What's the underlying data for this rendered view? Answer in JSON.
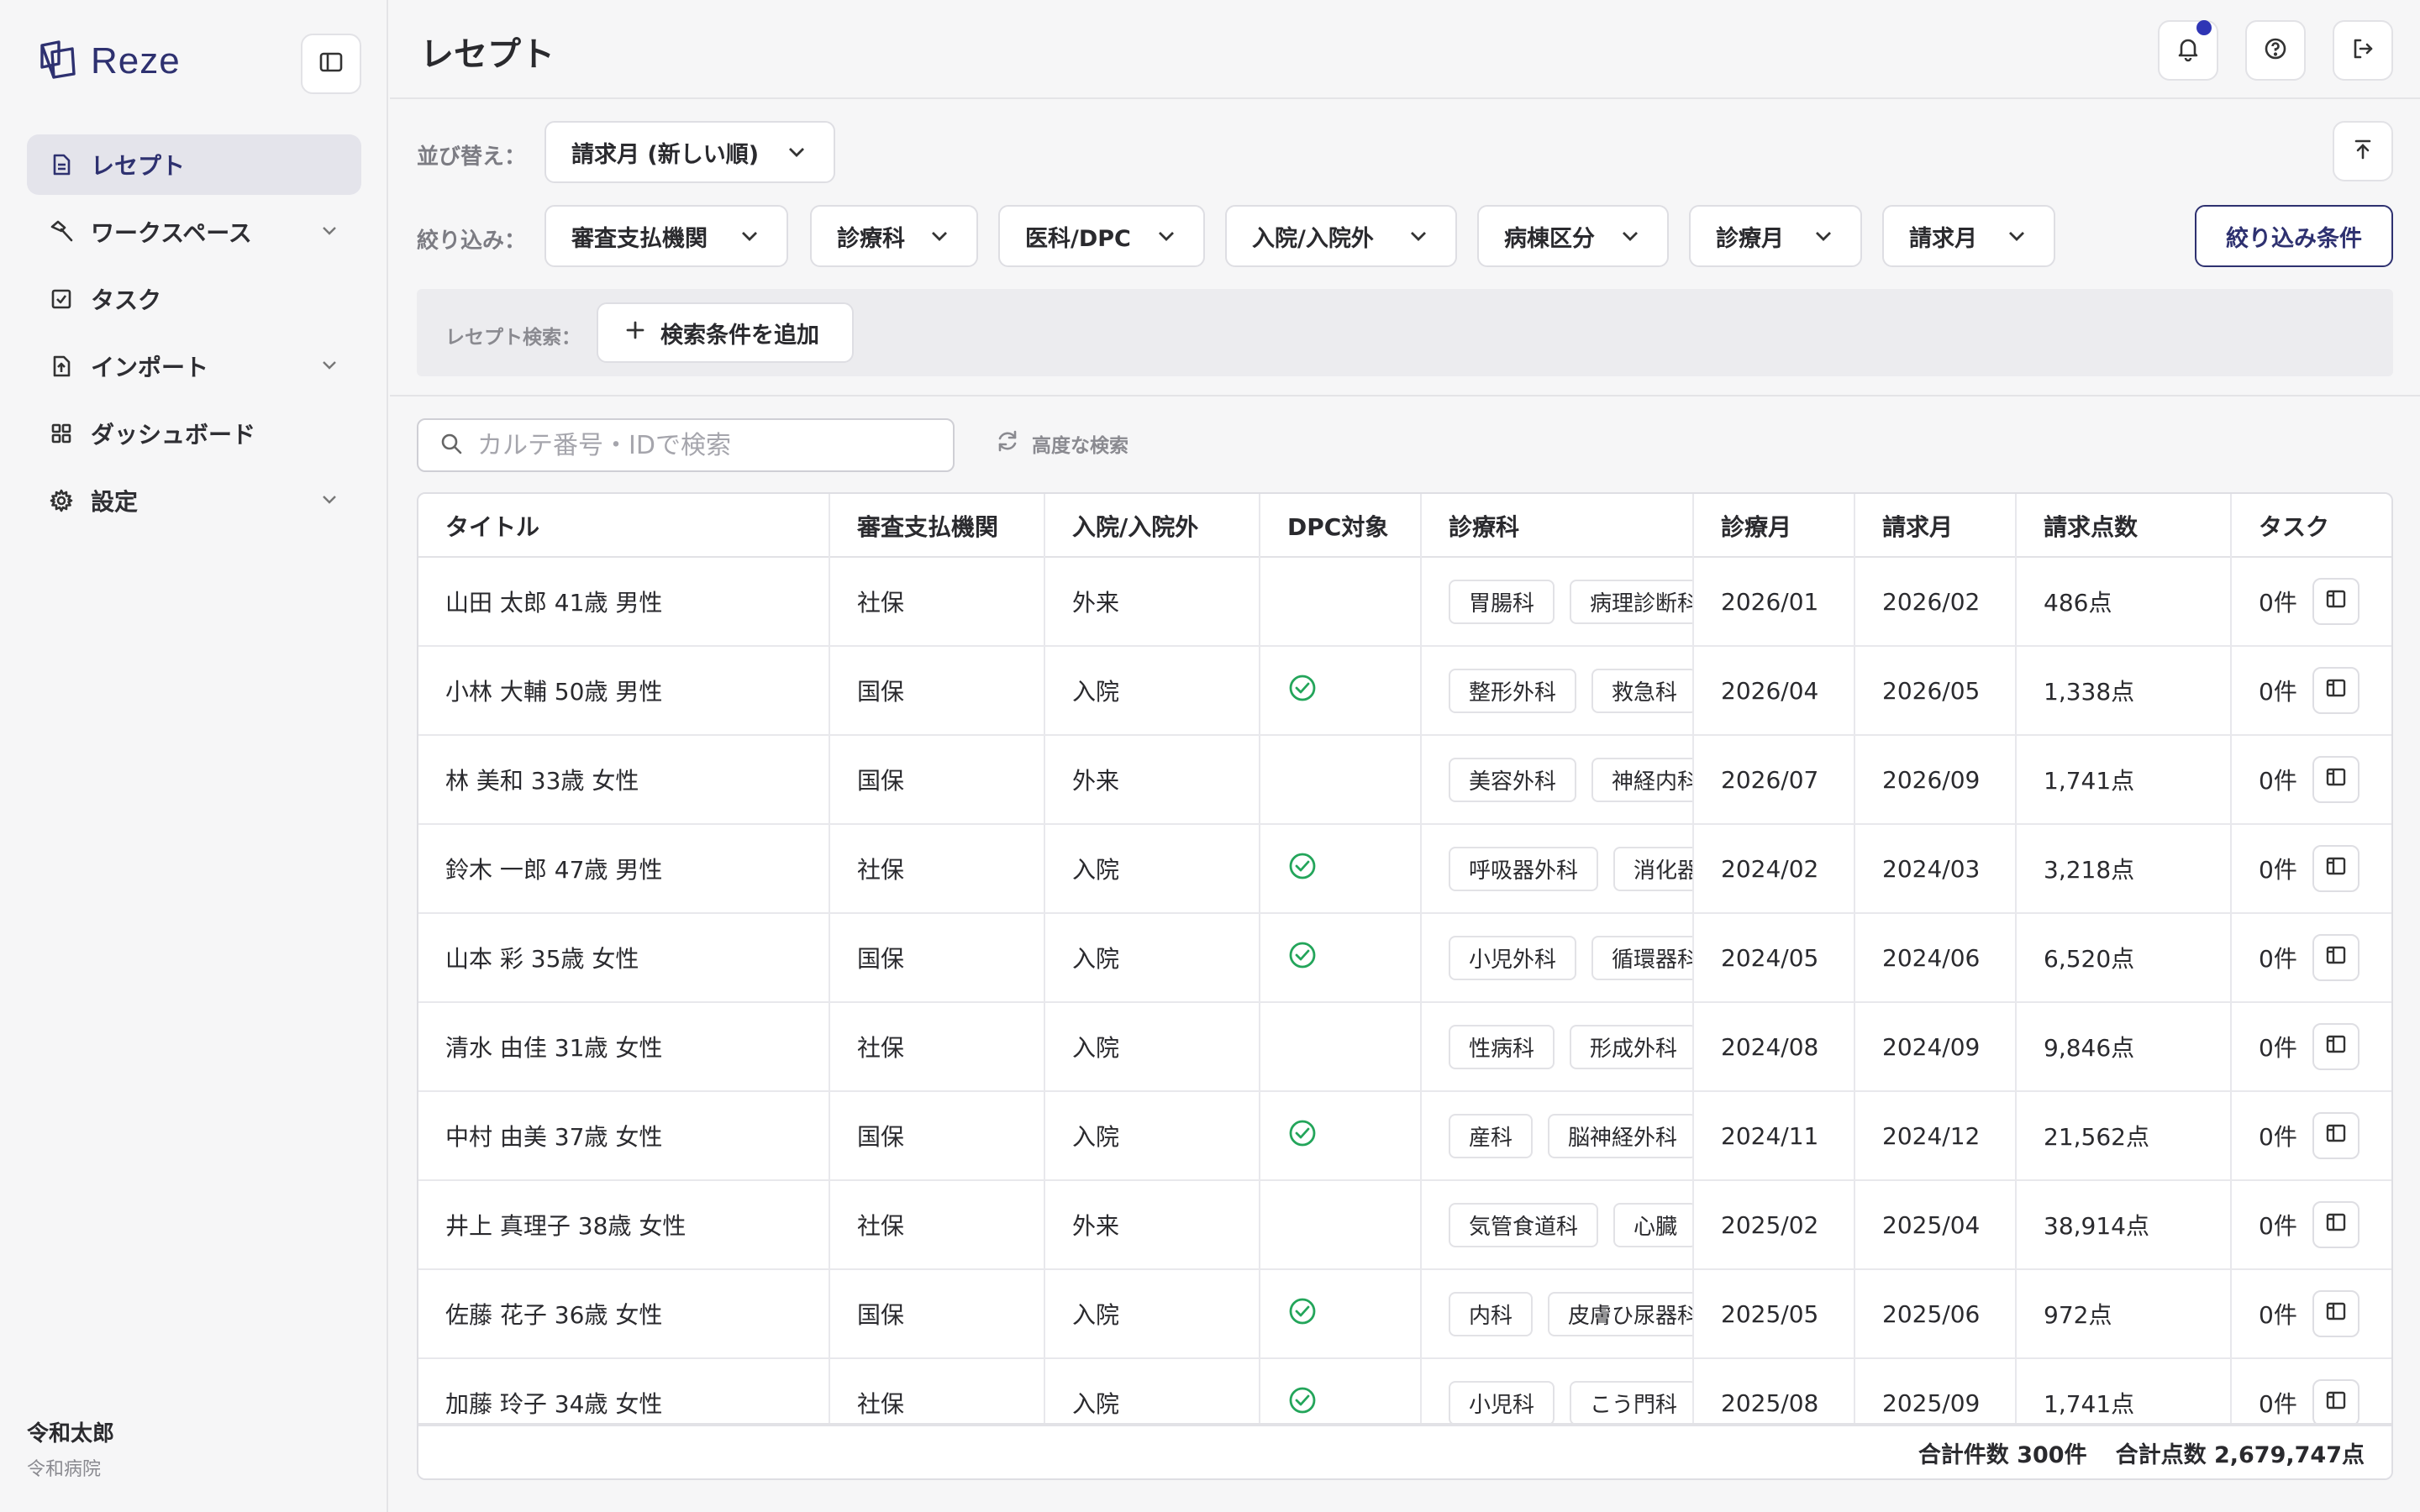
{
  "app": {
    "name": "Reze"
  },
  "sidebar": {
    "items": [
      {
        "label": "レセプト",
        "icon": "document-icon",
        "active": true,
        "expandable": false
      },
      {
        "label": "ワークスペース",
        "icon": "hammer-icon",
        "active": false,
        "expandable": true
      },
      {
        "label": "タスク",
        "icon": "checkbox-icon",
        "active": false,
        "expandable": false
      },
      {
        "label": "インポート",
        "icon": "file-import-icon",
        "active": false,
        "expandable": true
      },
      {
        "label": "ダッシュボード",
        "icon": "grid-icon",
        "active": false,
        "expandable": false
      },
      {
        "label": "設定",
        "icon": "gear-icon",
        "active": false,
        "expandable": true
      }
    ],
    "user": {
      "name": "令和太郎",
      "org": "令和病院"
    }
  },
  "header": {
    "title": "レセプト"
  },
  "colors": {
    "accent": "#2e3170",
    "notification": "#2f35b5",
    "check": "#23a55a"
  },
  "sort": {
    "label": "並び替え：",
    "value": "請求月 (新しい順)"
  },
  "filter": {
    "label": "絞り込み：",
    "dropdowns": [
      "審査支払機関",
      "診療科",
      "医科/DPC",
      "入院/入院外",
      "病棟区分",
      "診療月",
      "請求月"
    ],
    "conditions_button": "絞り込み条件"
  },
  "receipt_search": {
    "label": "レセプト検索：",
    "add_button": "検索条件を追加"
  },
  "search": {
    "placeholder": "カルテ番号・IDで検索",
    "advanced": "高度な検索"
  },
  "table": {
    "columns": [
      "タイトル",
      "審査支払機関",
      "入院/入院外",
      "DPC対象",
      "診療科",
      "診療月",
      "請求月",
      "請求点数",
      "タスク"
    ],
    "rows": [
      {
        "title": "山田 太郎  41歳  男性",
        "payer": "社保",
        "inout": "外来",
        "dpc": false,
        "depts": [
          "胃腸科",
          "病理診断科"
        ],
        "treat_month": "2026/01",
        "bill_month": "2026/02",
        "points": "486点",
        "tasks": "0件"
      },
      {
        "title": "小林 大輔  50歳  男性",
        "payer": "国保",
        "inout": "入院",
        "dpc": true,
        "depts": [
          "整形外科",
          "救急科"
        ],
        "treat_month": "2026/04",
        "bill_month": "2026/05",
        "points": "1,338点",
        "tasks": "0件"
      },
      {
        "title": "林 美和  33歳  女性",
        "payer": "国保",
        "inout": "外来",
        "dpc": false,
        "depts": [
          "美容外科",
          "神経内科"
        ],
        "treat_month": "2026/07",
        "bill_month": "2026/09",
        "points": "1,741点",
        "tasks": "0件"
      },
      {
        "title": "鈴木 一郎  47歳  男性",
        "payer": "社保",
        "inout": "入院",
        "dpc": true,
        "depts": [
          "呼吸器外科",
          "消化器科"
        ],
        "treat_month": "2024/02",
        "bill_month": "2024/03",
        "points": "3,218点",
        "tasks": "0件"
      },
      {
        "title": "山本 彩  35歳  女性",
        "payer": "国保",
        "inout": "入院",
        "dpc": true,
        "depts": [
          "小児外科",
          "循環器科"
        ],
        "treat_month": "2024/05",
        "bill_month": "2024/06",
        "points": "6,520点",
        "tasks": "0件"
      },
      {
        "title": "清水 由佳  31歳  女性",
        "payer": "社保",
        "inout": "入院",
        "dpc": false,
        "depts": [
          "性病科",
          "形成外科"
        ],
        "treat_month": "2024/08",
        "bill_month": "2024/09",
        "points": "9,846点",
        "tasks": "0件"
      },
      {
        "title": "中村 由美  37歳  女性",
        "payer": "国保",
        "inout": "入院",
        "dpc": true,
        "depts": [
          "産科",
          "脳神経外科"
        ],
        "treat_month": "2024/11",
        "bill_month": "2024/12",
        "points": "21,562点",
        "tasks": "0件"
      },
      {
        "title": "井上 真理子  38歳  女性",
        "payer": "社保",
        "inout": "外来",
        "dpc": false,
        "depts": [
          "気管食道科",
          "心臓"
        ],
        "treat_month": "2025/02",
        "bill_month": "2025/04",
        "points": "38,914点",
        "tasks": "0件"
      },
      {
        "title": "佐藤 花子  36歳  女性",
        "payer": "国保",
        "inout": "入院",
        "dpc": true,
        "depts": [
          "内科",
          "皮膚ひ尿器科"
        ],
        "treat_month": "2025/05",
        "bill_month": "2025/06",
        "points": "972点",
        "tasks": "0件"
      },
      {
        "title": "加藤 玲子  34歳  女性",
        "payer": "社保",
        "inout": "入院",
        "dpc": true,
        "depts": [
          "小児科",
          "こう門科"
        ],
        "treat_month": "2025/08",
        "bill_month": "2025/09",
        "points": "1,741点",
        "tasks": "0件"
      }
    ],
    "footer": {
      "count": "合計件数 300件",
      "points": "合計点数 2,679,747点"
    }
  }
}
